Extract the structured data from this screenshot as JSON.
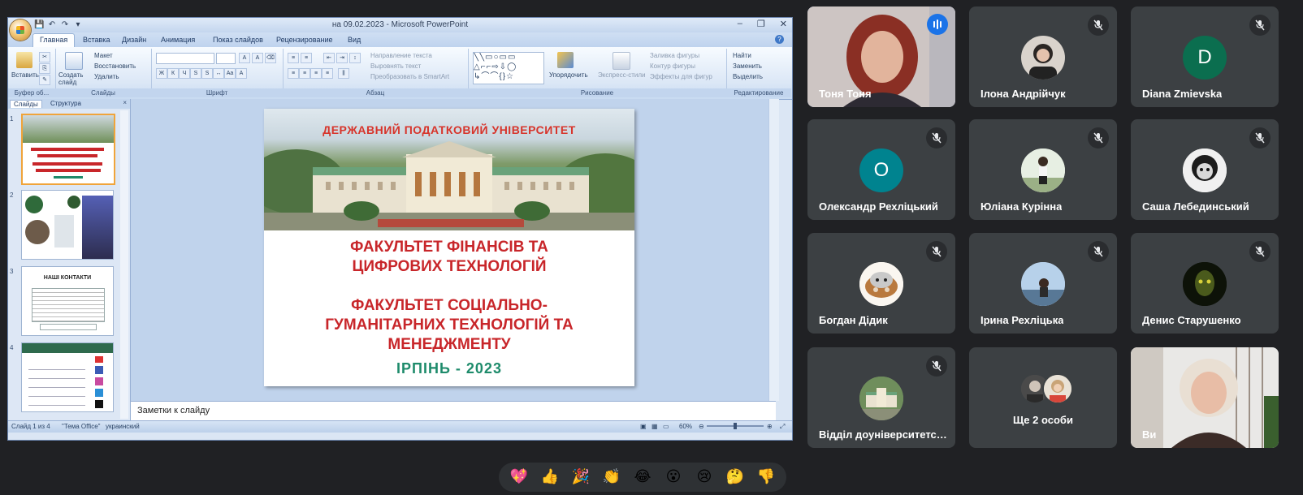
{
  "powerpoint": {
    "window_title": "на 09.02.2023 - Microsoft PowerPoint",
    "quick_access": [
      "💾",
      "↶",
      "↷",
      "▾"
    ],
    "window_controls": [
      "–",
      "❐",
      "✕"
    ],
    "tabs": [
      "Главная",
      "Вставка",
      "Дизайн",
      "Анимация",
      "Показ слайдов",
      "Рецензирование",
      "Вид"
    ],
    "ribbon": {
      "clipboard": {
        "paste": "Вставить",
        "group": "Буфер об..."
      },
      "slides": {
        "new_slide": "Создать слайд",
        "layout": "Макет",
        "reset": "Восстановить",
        "delete": "Удалить",
        "group": "Слайды"
      },
      "font": {
        "group": "Шрифт"
      },
      "paragraph": {
        "text_direction": "Направление текста",
        "align_text": "Выровнять текст",
        "smartart": "Преобразовать в SmartArt",
        "group": "Абзац"
      },
      "drawing": {
        "arrange": "Упорядочить",
        "quick_styles": "Экспресс-стили",
        "fill": "Заливка фигуры",
        "outline": "Контур фигуры",
        "effects": "Эффекты для фигур",
        "group": "Рисование"
      },
      "editing": {
        "find": "Найти",
        "replace": "Заменить",
        "select": "Выделить",
        "group": "Редактирование"
      }
    },
    "pane_tabs": [
      "Слайды",
      "Структура"
    ],
    "thumbnails": [
      "1",
      "2",
      "3",
      "4"
    ],
    "thumb3_title": "НАШІ КОНТАКТИ",
    "slide": {
      "banner": "ДЕРЖАВНИЙ ПОДАТКОВИЙ УНІВЕРСИТЕТ",
      "faculty1_line1": "ФАКУЛЬТЕТ ФІНАНСІВ ТА",
      "faculty1_line2": "ЦИФРОВИХ ТЕХНОЛОГІЙ",
      "faculty2_line1": "ФАКУЛЬТЕТ СОЦІАЛЬНО-",
      "faculty2_line2": "ГУМАНІТАРНИХ ТЕХНОЛОГІЙ ТА",
      "faculty2_line3": "МЕНЕДЖМЕНТУ",
      "city_year": "ІРПІНЬ  -  2023"
    },
    "notes_placeholder": "Заметки к слайду",
    "status": {
      "slide_counter": "Слайд 1 из 4",
      "theme": "\"Тема Office\"",
      "language": "украинский",
      "zoom": "60%"
    }
  },
  "meet": {
    "participants": [
      {
        "name": "Тоня Тоня",
        "state": "speaking"
      },
      {
        "name": "Ілона Андрійчук",
        "state": "muted"
      },
      {
        "name": "Diana Zmievska",
        "state": "muted",
        "letter": "D",
        "color": "#0b6e4f"
      },
      {
        "name": "Олександр Рехліцький",
        "state": "muted",
        "letter": "О",
        "color": "#00838f"
      },
      {
        "name": "Юліана Курінна",
        "state": "muted"
      },
      {
        "name": "Саша Лебединський",
        "state": "muted"
      },
      {
        "name": "Богдан Дідик",
        "state": "muted"
      },
      {
        "name": "Ірина Рехліцька",
        "state": "muted"
      },
      {
        "name": "Денис Старушенко",
        "state": "muted"
      },
      {
        "name": "Відділ доуніверситетської підготовки",
        "state": "muted"
      },
      {
        "name": "Ще 2 особи",
        "state": "more"
      },
      {
        "name": "Ви",
        "state": "self"
      }
    ],
    "reactions": [
      "💖",
      "👍",
      "🎉",
      "👏",
      "😂",
      "😮",
      "😢",
      "🤔",
      "👎"
    ]
  },
  "icons": [
    "microphone-off-icon",
    "audio-level-icon",
    "office-button-icon",
    "help-icon"
  ],
  "colors": {
    "meet_bg": "#202124",
    "tile_bg": "#3c4043",
    "speaking": "#1a73e8",
    "slide_red": "#c8262a",
    "slide_green": "#1e8b6b"
  }
}
